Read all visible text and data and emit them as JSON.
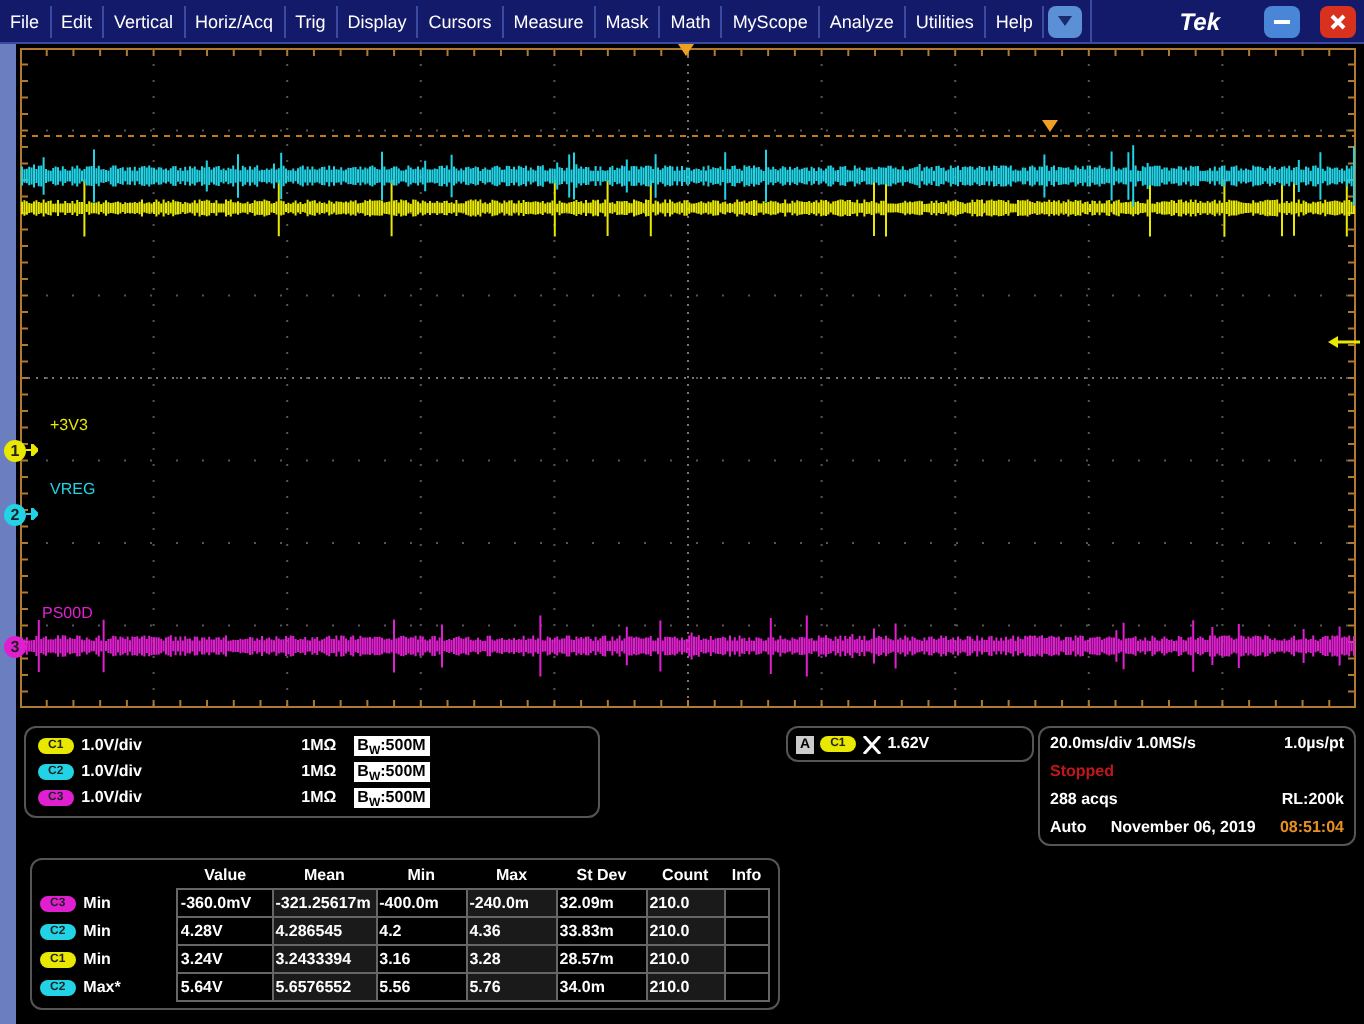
{
  "menu_bar": {
    "items": [
      "File",
      "Edit",
      "Vertical",
      "Horiz/Acq",
      "Trig",
      "Display",
      "Cursors",
      "Measure",
      "Mask",
      "Math",
      "MyScope",
      "Analyze",
      "Utilities",
      "Help"
    ],
    "brand": "Tek"
  },
  "traces": [
    {
      "name": "+3V3",
      "marker": "1",
      "color": "#e8e800"
    },
    {
      "name": "VREG",
      "marker": "2",
      "color": "#22d3e6"
    },
    {
      "name": "PS00D",
      "marker": "3",
      "color": "#e020d0"
    }
  ],
  "channels": [
    {
      "badge": "C1",
      "color": "#e8e800",
      "scale": "1.0V/div",
      "impedance": "1MΩ",
      "bandwidth": "B$_{W}$:500M"
    },
    {
      "badge": "C2",
      "color": "#22d3e6",
      "scale": "1.0V/div",
      "impedance": "1MΩ",
      "bandwidth": "B$_{W}$:500M"
    },
    {
      "badge": "C3",
      "color": "#e020d0",
      "scale": "1.0V/div",
      "impedance": "1MΩ",
      "bandwidth": "B$_{W}$:500M"
    }
  ],
  "trigger": {
    "mode": "A",
    "badge": "C1",
    "color": "#e8e800",
    "level": "1.62V"
  },
  "acquisition": {
    "timebase": "20.0ms/div 1.0MS/s",
    "resolution": "1.0µs/pt",
    "state": "Stopped",
    "acqs": "288 acqs",
    "record_length": "RL:200k",
    "trigger_mode": "Auto",
    "date": "November 06, 2019",
    "time": "08:51:04"
  },
  "measurements": {
    "columns": [
      "Value",
      "Mean",
      "Min",
      "Max",
      "St Dev",
      "Count",
      "Info"
    ],
    "rows": [
      {
        "badge": "C3",
        "color": "#e020d0",
        "type": "Min",
        "cells": [
          "-360.0mV",
          "-321.25617m",
          "-400.0m",
          "-240.0m",
          "32.09m",
          "210.0"
        ]
      },
      {
        "badge": "C2",
        "color": "#22d3e6",
        "type": "Min",
        "cells": [
          "4.28V",
          "4.286545",
          "4.2",
          "4.36",
          "33.83m",
          "210.0"
        ]
      },
      {
        "badge": "C1",
        "color": "#e8e800",
        "type": "Min",
        "cells": [
          "3.24V",
          "3.2433394",
          "3.16",
          "3.28",
          "28.57m",
          "210.0"
        ]
      },
      {
        "badge": "C2",
        "color": "#22d3e6",
        "type": "Max*",
        "cells": [
          "5.64V",
          "5.6576552",
          "5.56",
          "5.76",
          "34.0m",
          "210.0"
        ]
      }
    ]
  }
}
